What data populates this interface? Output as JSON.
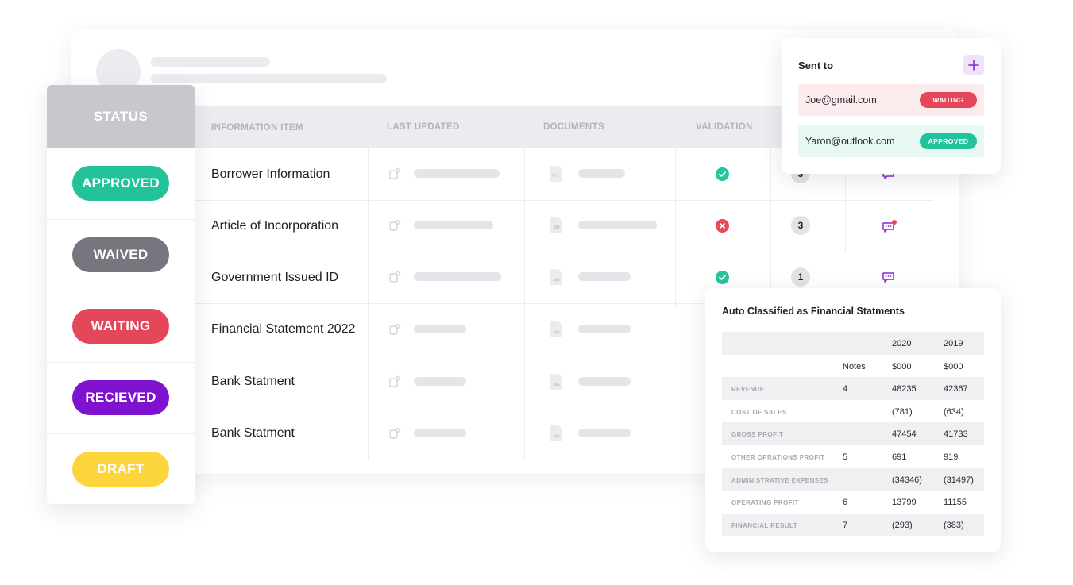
{
  "table": {
    "headers": {
      "item": "INFORMATION ITEM",
      "updated": "LAST UPDATED",
      "documents": "DOCUMENTS",
      "validation": "VALIDATION"
    },
    "rows": [
      {
        "label": "Borrower Information",
        "doc_icon": "pdf-file-icon",
        "validation": "valid",
        "count": "3",
        "comment_icon": "chat-icon"
      },
      {
        "label": "Article of Incorporation",
        "doc_icon": "word-file-icon",
        "validation": "invalid",
        "count": "3",
        "comment_icon": "chat-notification-icon"
      },
      {
        "label": "Government Issued ID",
        "doc_icon": "image-file-icon",
        "validation": "valid",
        "count": "1",
        "comment_icon": "chat-icon"
      },
      {
        "label": "Financial Statement 2022",
        "doc_icon": "image-file-icon"
      },
      {
        "label": "Bank Statment",
        "doc_icon": "image-file-icon"
      },
      {
        "label": "Bank Statment",
        "doc_icon": "image-file-icon"
      }
    ]
  },
  "status_panel": {
    "title": "STATUS",
    "items": [
      {
        "label": "APPROVED",
        "color": "#22c39a"
      },
      {
        "label": "WAIVED",
        "color": "#76767e"
      },
      {
        "label": "WAITING",
        "color": "#e4465a"
      },
      {
        "label": "RECIEVED",
        "color": "#7f12cf"
      },
      {
        "label": "DRAFT",
        "color": "#fcd43c"
      }
    ]
  },
  "sent_to": {
    "title": "Sent to",
    "add_icon": "plus-icon",
    "recipients": [
      {
        "email": "Joe@gmail.com",
        "status": "WAITING",
        "status_color": "#e4465a",
        "bg": "#fcecee"
      },
      {
        "email": "Yaron@outlook.com",
        "status": "APPROVED",
        "status_color": "#22c39a",
        "bg": "#e8f8f3"
      }
    ]
  },
  "financial": {
    "title": "Auto Classified as Financial Statments",
    "header1": {
      "y2020": "2020",
      "y2019": "2019"
    },
    "header2": {
      "notes": "Notes",
      "y2020": "$000",
      "y2019": "$000"
    },
    "rows": [
      {
        "label": "REVENUE",
        "notes": "4",
        "y2020": "48235",
        "y2019": "42367"
      },
      {
        "label": "COST OF SALES",
        "notes": "",
        "y2020": "(781)",
        "y2019": "(634)"
      },
      {
        "label": "GROSS PROFIT",
        "notes": "",
        "y2020": "47454",
        "y2019": "41733"
      },
      {
        "label": "OTHER OPRATIONS PROFIT",
        "notes": "5",
        "y2020": "691",
        "y2019": "919"
      },
      {
        "label": "ADMINISTRATIVE EXPENSES",
        "notes": "",
        "y2020": "(34346)",
        "y2019": "(31497)"
      },
      {
        "label": "OPERATING PROFIT",
        "notes": "6",
        "y2020": "13799",
        "y2019": "11155"
      },
      {
        "label": "FINANCIAL RESULT",
        "notes": "7",
        "y2020": "(293)",
        "y2019": "(383)"
      }
    ]
  },
  "colors": {
    "accent": "#8a28d6",
    "valid": "#27c59e",
    "invalid": "#e94a56",
    "placeholder": "#e4e4e9"
  }
}
